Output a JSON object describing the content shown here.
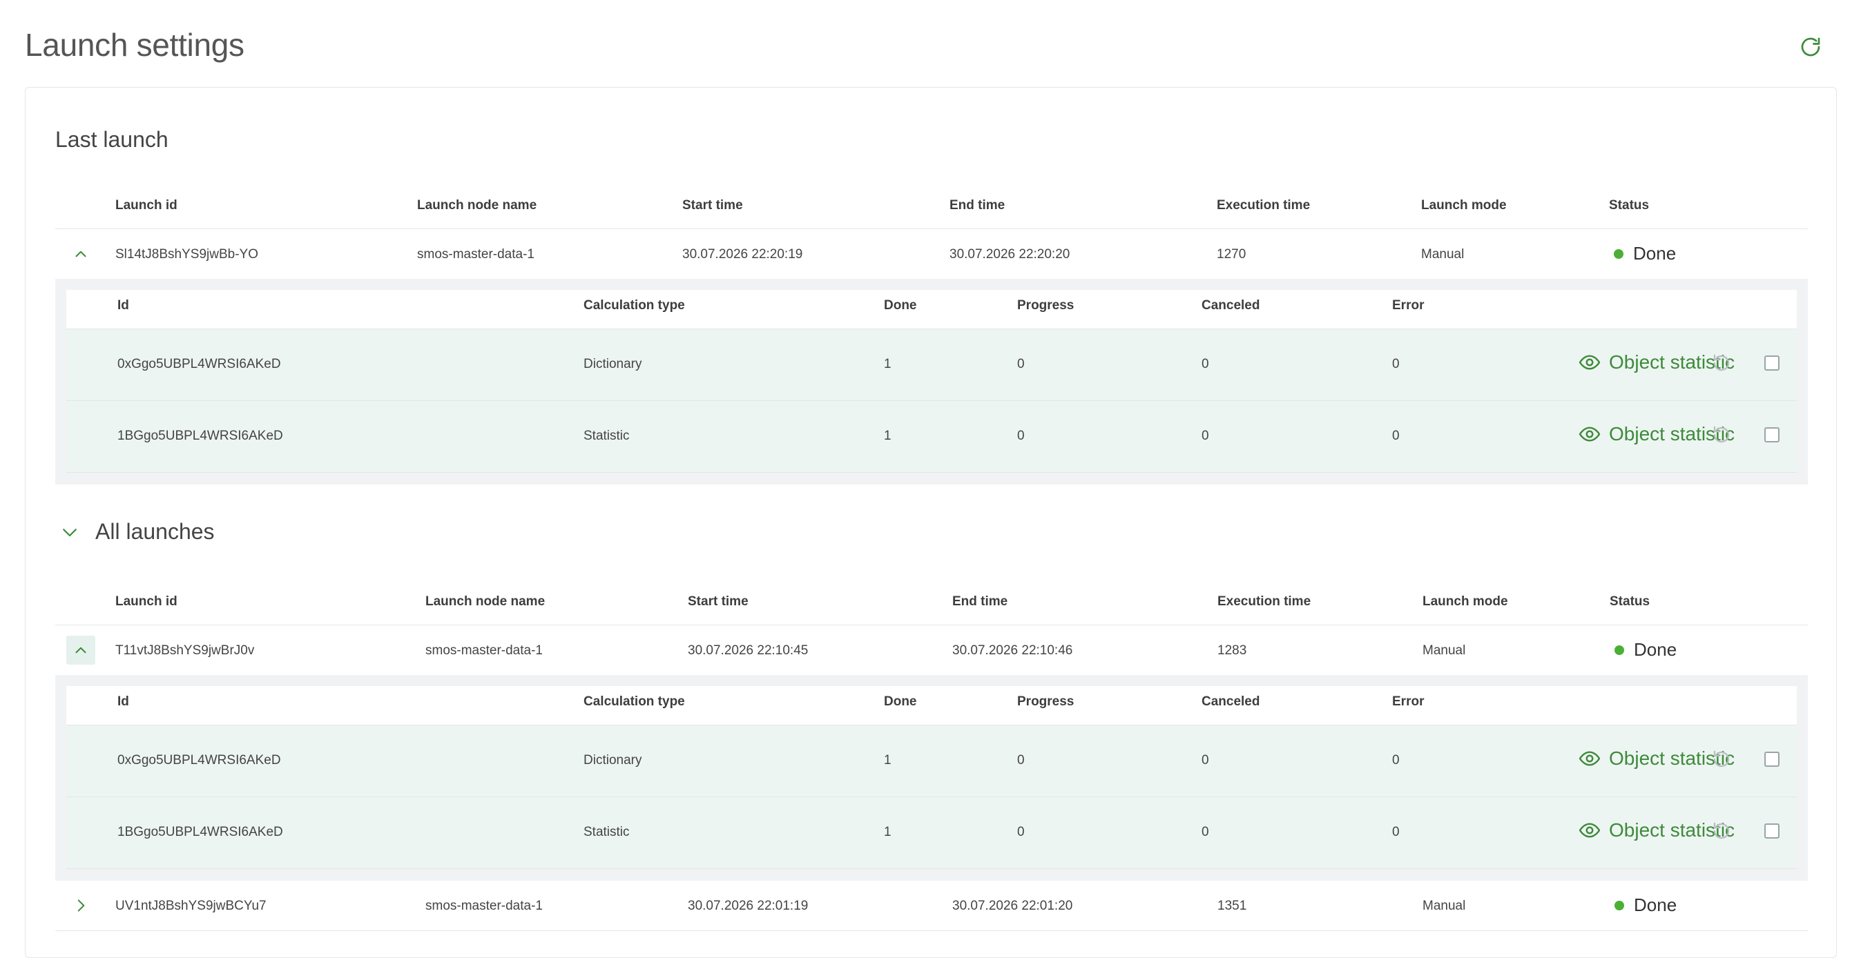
{
  "page": {
    "title": "Launch settings"
  },
  "colors": {
    "accent": "#3e8a3a",
    "status_done": "#4caf35",
    "row_tint": "#edf5f2",
    "expander_active": "#e5f1ec"
  },
  "icons": {
    "refresh": "refresh-icon",
    "collapse": "chevron-up-icon",
    "expand_section": "chevron-down-icon",
    "expand_row": "chevron-right-icon",
    "view": "eye-icon",
    "undo": "undo-icon"
  },
  "last_launch": {
    "title": "Last launch",
    "columns": [
      "Launch id",
      "Launch node name",
      "Start time",
      "End time",
      "Execution time",
      "Launch mode",
      "Status"
    ],
    "row": {
      "id": "Sl14tJ8BshYS9jwBb-YO",
      "node": "smos-master-data-1",
      "start": "30.07.2026 22:20:19",
      "end": "30.07.2026 22:20:20",
      "exec": "1270",
      "mode": "Manual",
      "status": "Done"
    },
    "sub_columns": [
      "Id",
      "Calculation type",
      "Done",
      "Progress",
      "Canceled",
      "Error"
    ],
    "sub_rows": [
      {
        "id": "0xGgo5UBPL4WRSI6AKeD",
        "type": "Dictionary",
        "done": "1",
        "progress": "0",
        "canceled": "0",
        "error": "0",
        "action": "Object statistic"
      },
      {
        "id": "1BGgo5UBPL4WRSI6AKeD",
        "type": "Statistic",
        "done": "1",
        "progress": "0",
        "canceled": "0",
        "error": "0",
        "action": "Object statistic"
      }
    ]
  },
  "all_launches": {
    "title": "All launches",
    "columns": [
      "Launch id",
      "Launch node name",
      "Start time",
      "End time",
      "Execution time",
      "Launch mode",
      "Status"
    ],
    "rows": [
      {
        "id": "T11vtJ8BshYS9jwBrJ0v",
        "node": "smos-master-data-1",
        "start": "30.07.2026 22:10:45",
        "end": "30.07.2026 22:10:46",
        "exec": "1283",
        "mode": "Manual",
        "status": "Done"
      },
      {
        "id": "UV1ntJ8BshYS9jwBCYu7",
        "node": "smos-master-data-1",
        "start": "30.07.2026 22:01:19",
        "end": "30.07.2026 22:01:20",
        "exec": "1351",
        "mode": "Manual",
        "status": "Done"
      }
    ],
    "sub_columns": [
      "Id",
      "Calculation type",
      "Done",
      "Progress",
      "Canceled",
      "Error"
    ],
    "sub_rows": [
      {
        "id": "0xGgo5UBPL4WRSI6AKeD",
        "type": "Dictionary",
        "done": "1",
        "progress": "0",
        "canceled": "0",
        "error": "0",
        "action": "Object statistic"
      },
      {
        "id": "1BGgo5UBPL4WRSI6AKeD",
        "type": "Statistic",
        "done": "1",
        "progress": "0",
        "canceled": "0",
        "error": "0",
        "action": "Object statistic"
      }
    ]
  }
}
